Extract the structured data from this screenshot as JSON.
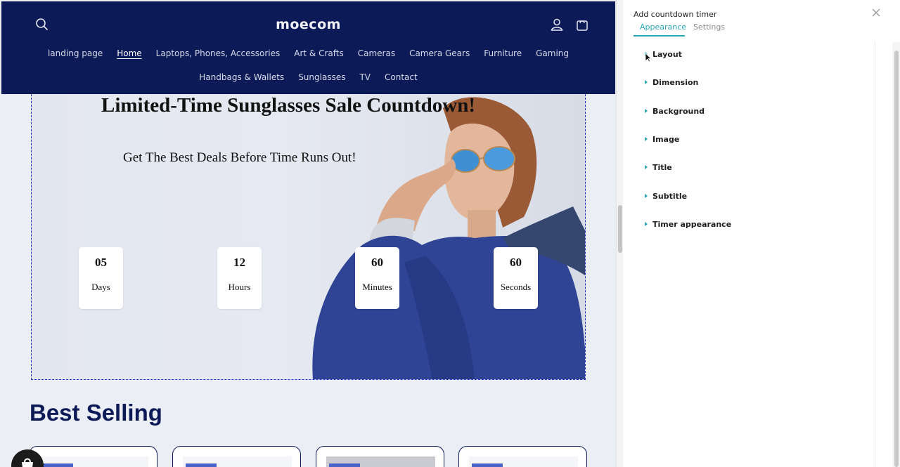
{
  "store": {
    "logo": "moecom",
    "nav_row1": [
      "landing page",
      "Home",
      "Laptops, Phones, Accessories",
      "Art & Crafts",
      "Cameras",
      "Camera Gears",
      "Furniture",
      "Gaming"
    ],
    "nav_row2": [
      "Handbags & Wallets",
      "Sunglasses",
      "TV",
      "Contact"
    ],
    "active_nav": "Home"
  },
  "hero": {
    "title": "Limited-Time Sunglasses Sale Countdown!",
    "subtitle": "Get The Best Deals Before Time Runs Out!",
    "timer": [
      {
        "value": "05",
        "label": "Days"
      },
      {
        "value": "12",
        "label": "Hours"
      },
      {
        "value": "60",
        "label": "Minutes"
      },
      {
        "value": "60",
        "label": "Seconds"
      }
    ]
  },
  "best_selling": {
    "heading": "Best Selling"
  },
  "panel": {
    "title": "Add countdown timer",
    "tabs": {
      "appearance": "Appearance",
      "settings": "Settings"
    },
    "active_tab": "Appearance",
    "sections": [
      "Layout",
      "Dimension",
      "Background",
      "Image",
      "Title",
      "Subtitle",
      "Timer appearance"
    ]
  },
  "colors": {
    "header_bg": "#0c1a57",
    "accent": "#2aa7b6",
    "hero_border": "#2331c9",
    "heading": "#0c1a57"
  },
  "icons": {
    "header": [
      "search-icon",
      "account-icon",
      "cart-icon"
    ],
    "panel": [
      "close-icon",
      "caret-right-icon"
    ]
  }
}
